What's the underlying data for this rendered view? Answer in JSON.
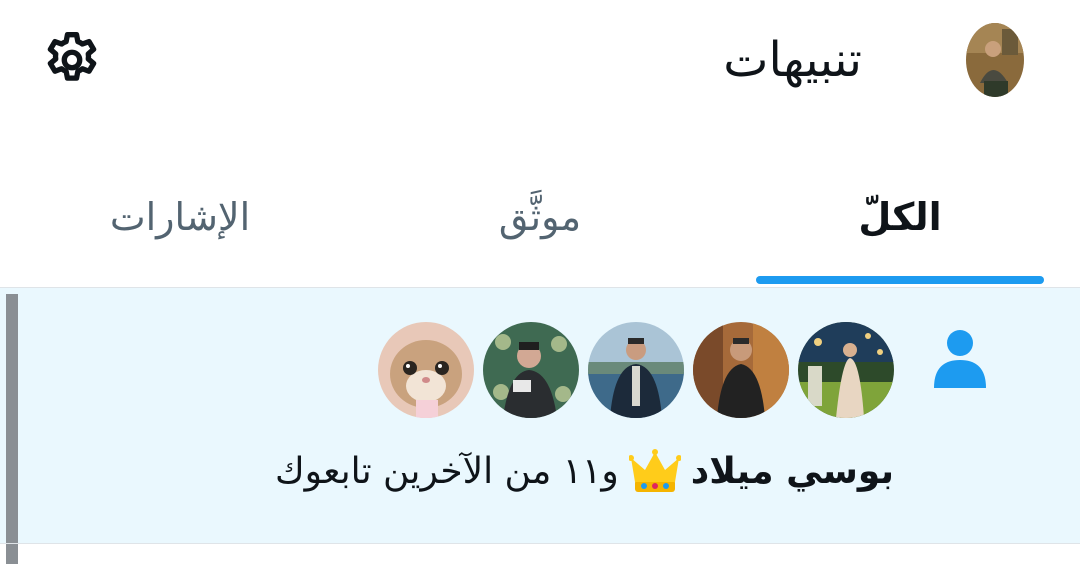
{
  "header": {
    "title": "تنبيهات",
    "settings_icon": "gear-icon",
    "profile_avatar": "profile-avatar"
  },
  "tabs": [
    {
      "label": "الكلّ",
      "active": true
    },
    {
      "label": "موثَّق",
      "active": false
    },
    {
      "label": "الإشارات",
      "active": false
    }
  ],
  "notification": {
    "type_icon": "person-icon",
    "name": "بوسي ميلاد",
    "emoji": "👑",
    "rest": "و١١ من الآخرين تابعوك",
    "avatars": [
      "follower-avatar-1",
      "follower-avatar-2",
      "follower-avatar-3",
      "follower-avatar-4",
      "follower-avatar-5"
    ]
  },
  "colors": {
    "accent": "#1d9bf0",
    "highlight_bg": "#eaf8fe",
    "text_primary": "#0f1419",
    "text_secondary": "#536471"
  }
}
